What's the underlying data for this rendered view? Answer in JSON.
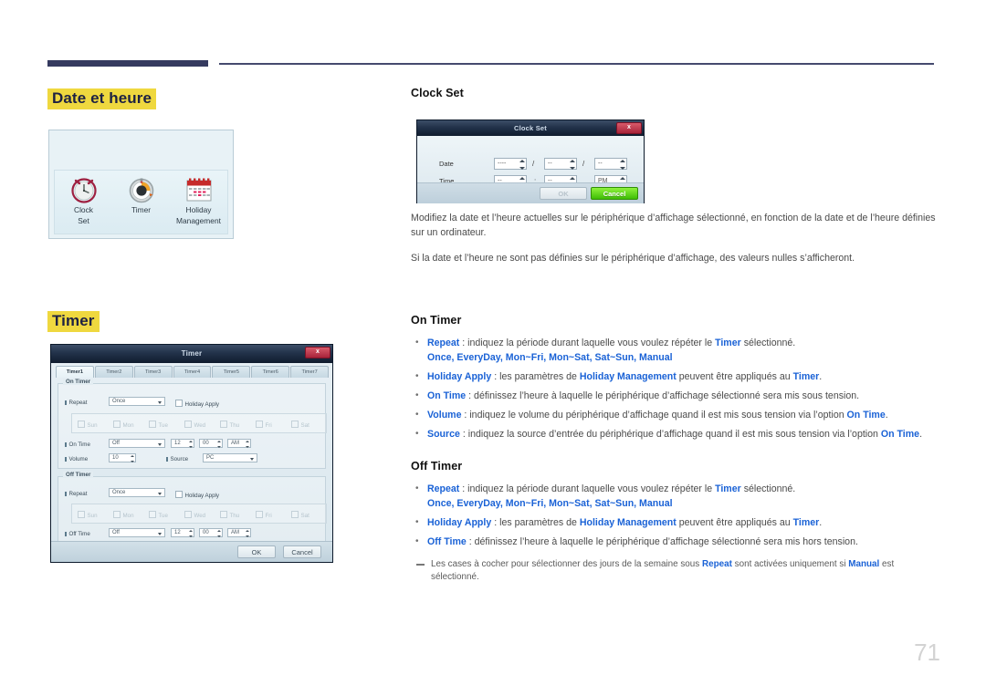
{
  "page": {
    "number": "71"
  },
  "sections": {
    "date_time": {
      "heading": "Date et heure"
    },
    "timer": {
      "heading": "Timer"
    }
  },
  "icon_panel": {
    "items": [
      {
        "icon": "alarm-clock-icon",
        "label_line1": "Clock",
        "label_line2": "Set"
      },
      {
        "icon": "stopwatch-timer-icon",
        "label_line1": "Timer",
        "label_line2": ""
      },
      {
        "icon": "calendar-holiday-icon",
        "label_line1": "Holiday",
        "label_line2": "Management"
      }
    ]
  },
  "clock_set_dialog": {
    "title": "Clock Set",
    "close_label": "x",
    "rows": [
      {
        "label": "Date",
        "f1": "----",
        "sep1": "/",
        "f2": "--",
        "sep2": "/",
        "f3": "--"
      },
      {
        "label": "Time",
        "f1": "--",
        "sep1": ":",
        "f2": "--",
        "f3": "PM"
      }
    ],
    "ok_label": "OK",
    "cancel_label": "Cancel"
  },
  "timer_dialog": {
    "title": "Timer",
    "close_label": "x",
    "tabs": [
      "Timer1",
      "Timer2",
      "Timer3",
      "Timer4",
      "Timer5",
      "Timer6",
      "Timer7"
    ],
    "on_timer": {
      "caption": "On Timer",
      "repeat_label": "Repeat",
      "repeat_value": "Once",
      "holiday_apply": "Holiday Apply",
      "days": [
        "Sun",
        "Mon",
        "Tue",
        "Wed",
        "Thu",
        "Fri",
        "Sat"
      ],
      "on_time_label": "On Time",
      "on_time_value": "Off",
      "hour": "12",
      "minute": "00",
      "meridiem": "AM",
      "volume_label": "Volume",
      "volume_value": "10",
      "source_label": "Source",
      "source_value": "PC"
    },
    "off_timer": {
      "caption": "Off Timer",
      "repeat_label": "Repeat",
      "repeat_value": "Once",
      "holiday_apply": "Holiday Apply",
      "days": [
        "Sun",
        "Mon",
        "Tue",
        "Wed",
        "Thu",
        "Fri",
        "Sat"
      ],
      "off_time_label": "Off Time",
      "off_time_value": "Off",
      "hour": "12",
      "minute": "00",
      "meridiem": "AM"
    },
    "ok_label": "OK",
    "cancel_label": "Cancel"
  },
  "clock_set_text": {
    "heading": "Clock Set",
    "p1": "Modifiez la date et l’heure actuelles sur le périphérique d’affichage sélectionné, en fonction de la date et de l’heure définies sur un ordinateur.",
    "p2": "Si la date et l’heure ne sont pas définies sur le périphérique d’affichage, des valeurs nulles s’afficheront."
  },
  "on_timer_text": {
    "heading": "On Timer",
    "bullets": [
      {
        "term": "Repeat",
        "sep": " : ",
        "text_a": "indiquez la période durant laquelle vous voulez répéter le ",
        "term2": "Timer",
        "text_b": " sélectionné.",
        "options": "Once, EveryDay, Mon~Fri, Mon~Sat, Sat~Sun, Manual"
      },
      {
        "term": "Holiday Apply",
        "sep": " : ",
        "text_a": "les paramètres de ",
        "term2": "Holiday Management",
        "text_b": " peuvent être appliqués au ",
        "term3": "Timer",
        "text_c": "."
      },
      {
        "term": "On Time",
        "sep": " : ",
        "text_a": "définissez l’heure à laquelle le périphérique d’affichage sélectionné sera mis sous tension."
      },
      {
        "term": "Volume",
        "sep": " : ",
        "text_a": "indiquez le volume du périphérique d’affichage quand il est mis sous tension via l’option ",
        "term2": "On Time",
        "text_b": "."
      },
      {
        "term": "Source",
        "sep": " : ",
        "text_a": "indiquez la source d’entrée du périphérique d’affichage quand il est mis sous tension via l’option ",
        "term2": "On Time",
        "text_b": "."
      }
    ]
  },
  "off_timer_text": {
    "heading": "Off Timer",
    "bullets": [
      {
        "term": "Repeat",
        "sep": " : ",
        "text_a": "indiquez la période durant laquelle vous voulez répéter le ",
        "term2": "Timer",
        "text_b": " sélectionné.",
        "options": "Once, EveryDay, Mon~Fri, Mon~Sat, Sat~Sun, Manual"
      },
      {
        "term": "Holiday Apply",
        "sep": " : ",
        "text_a": "les paramètres de ",
        "term2": "Holiday Management",
        "text_b": " peuvent être appliqués au ",
        "term3": "Timer",
        "text_c": "."
      },
      {
        "term": "Off Time",
        "sep": " : ",
        "text_a": "définissez l’heure à laquelle le périphérique d’affichage sélectionné sera mis hors tension."
      }
    ],
    "note": {
      "text_a": "Les cases à cocher pour sélectionner des jours de la semaine sous ",
      "term": "Repeat",
      "text_b": " sont activées uniquement si ",
      "term2": "Manual",
      "text_c": " est sélectionné."
    }
  },
  "colors": {
    "accent_blue": "#1a62d6",
    "highlight_yellow": "#efd83f",
    "rule_navy": "#353a5f"
  }
}
